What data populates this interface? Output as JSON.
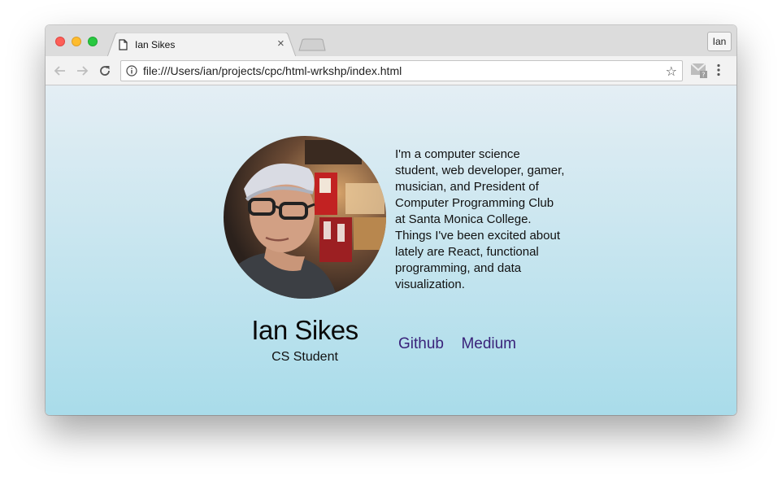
{
  "browser": {
    "tab_title": "Ian Sikes",
    "tab_close": "×",
    "profile_label": "Ian",
    "url": "file:///Users/ian/projects/cpc/html-wrkshp/index.html",
    "star": "☆"
  },
  "profile": {
    "name": "Ian Sikes",
    "role": "CS Student",
    "bio": "I'm a computer science student, web developer, gamer, musician, and President of Computer Programming Club at Santa Monica College. Things I've been excited about lately are React, functional programming, and data visualization.",
    "links": [
      {
        "label": "Github"
      },
      {
        "label": "Medium"
      }
    ]
  },
  "colors": {
    "link": "#3a237a",
    "gradient_top": "#e4eef4",
    "gradient_bottom": "#a9dcea"
  }
}
